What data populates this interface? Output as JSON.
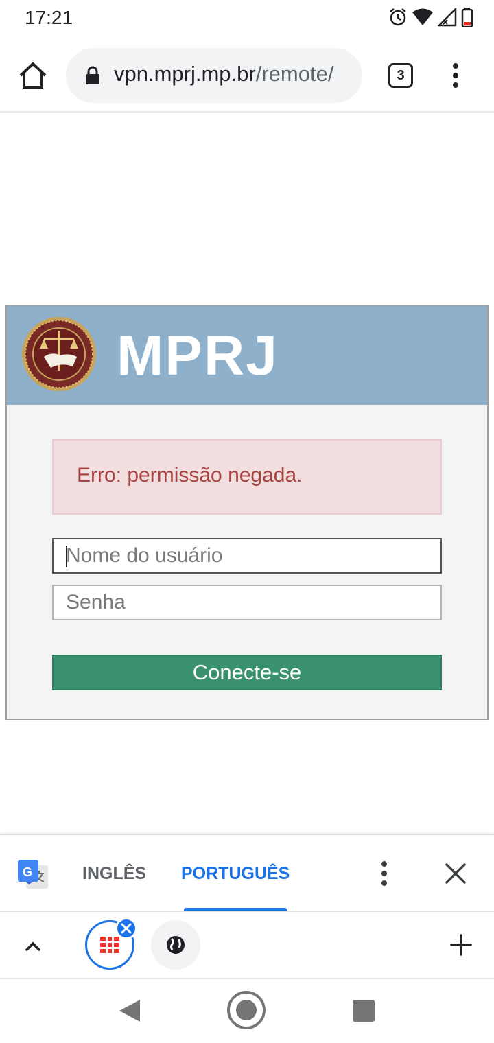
{
  "status_bar": {
    "time": "17:21",
    "icons": [
      "alarm-icon",
      "wifi-icon",
      "signal-icon",
      "battery-icon"
    ]
  },
  "browser": {
    "url_host": "vpn.mprj.mp.br",
    "url_path": "/remote/",
    "tab_count": "3",
    "icons": [
      "home-icon",
      "lock-icon",
      "overflow-menu-icon"
    ]
  },
  "login": {
    "brand": "MPRJ",
    "error_message": "Erro: permissão negada.",
    "username_placeholder": "Nome do usuário",
    "username_value": "",
    "password_placeholder": "Senha",
    "password_value": "",
    "submit_label": "Conecte-se"
  },
  "translate_bar": {
    "source_lang": "INGLÊS",
    "target_lang": "PORTUGUÊS",
    "selected": "PORTUGUÊS"
  },
  "tab_strip": {
    "tabs": [
      "fortinet-tab-icon",
      "globe-tab-icon"
    ]
  },
  "colors": {
    "header_bg": "#8eb0cb",
    "error_bg": "#f2dede",
    "error_text": "#a94442",
    "submit_bg": "#3a916e",
    "accent_blue": "#1a73e8"
  }
}
